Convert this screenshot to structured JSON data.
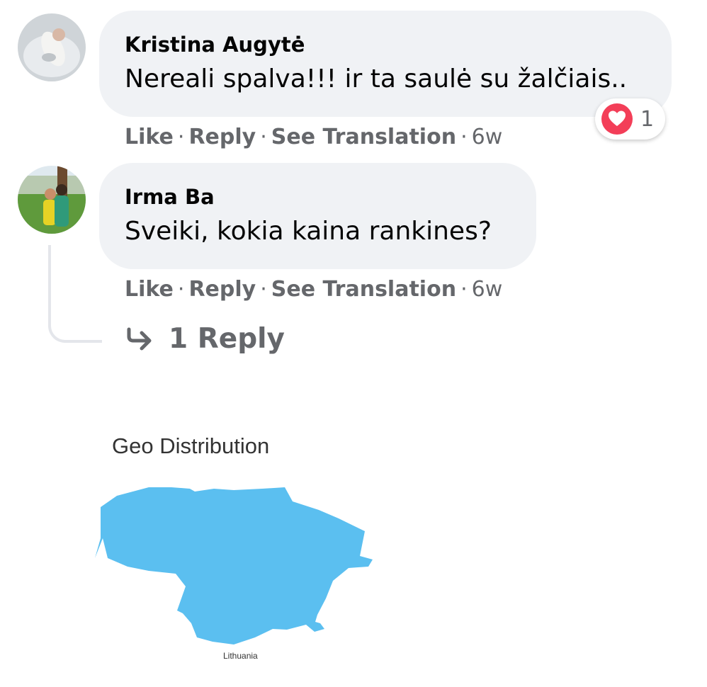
{
  "comments": [
    {
      "author": "Kristina Augytė",
      "text": "Nereali spalva!!! ir ta saulė su žalčiais..",
      "actions": {
        "like": "Like",
        "reply": "Reply",
        "translate": "See Translation",
        "time": "6w"
      },
      "reaction": {
        "icon": "love-heart-icon",
        "count": "1",
        "color": "#f33e58"
      }
    },
    {
      "author": "Irma Ba",
      "text": "Sveiki, kokia kaina rankines?",
      "actions": {
        "like": "Like",
        "reply": "Reply",
        "translate": "See Translation",
        "time": "6w"
      },
      "replies_link": "1 Reply"
    }
  ],
  "separator": "·",
  "geo": {
    "title": "Geo Distribution",
    "regions": [
      {
        "name": "Lithuania",
        "color": "#5bbff0"
      }
    ]
  }
}
